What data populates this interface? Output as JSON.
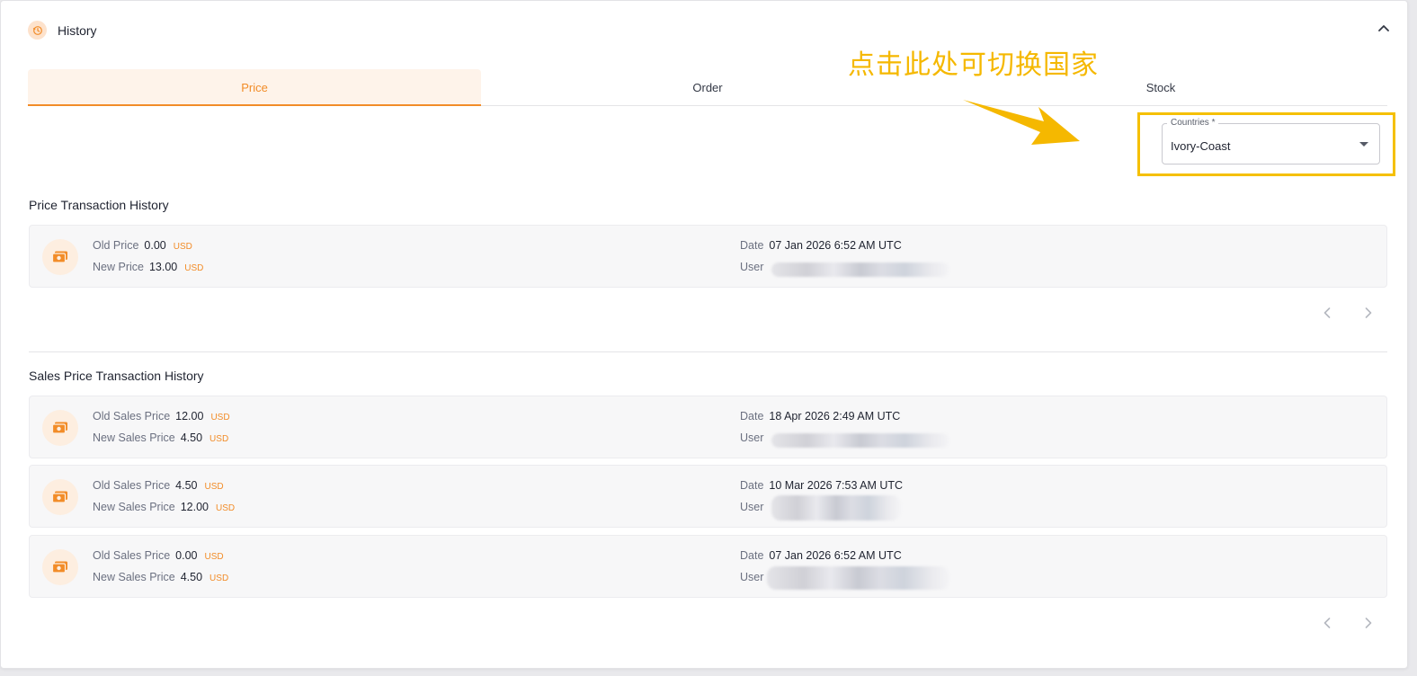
{
  "header": {
    "title": "History"
  },
  "tabs": [
    {
      "label": "Price",
      "active": true
    },
    {
      "label": "Order",
      "active": false
    },
    {
      "label": "Stock",
      "active": false
    }
  ],
  "annotation": {
    "text": "点击此处可切换国家"
  },
  "country_select": {
    "label": "Countries *",
    "value": "Ivory-Coast"
  },
  "price_history": {
    "title": "Price Transaction History",
    "rows": [
      {
        "old_label": "Old Price",
        "old_value": "0.00",
        "old_currency": "USD",
        "new_label": "New Price",
        "new_value": "13.00",
        "new_currency": "USD",
        "date_label": "Date",
        "date": "07 Jan 2026 6:52 AM UTC",
        "user_label": "User"
      }
    ]
  },
  "sales_price_history": {
    "title": "Sales Price Transaction History",
    "rows": [
      {
        "old_label": "Old Sales Price",
        "old_value": "12.00",
        "old_currency": "USD",
        "new_label": "New Sales Price",
        "new_value": "4.50",
        "new_currency": "USD",
        "date_label": "Date",
        "date": "18 Apr 2026 2:49 AM UTC",
        "user_label": "User"
      },
      {
        "old_label": "Old Sales Price",
        "old_value": "4.50",
        "old_currency": "USD",
        "new_label": "New Sales Price",
        "new_value": "12.00",
        "new_currency": "USD",
        "date_label": "Date",
        "date": "10 Mar 2026 7:53 AM UTC",
        "user_label": "User"
      },
      {
        "old_label": "Old Sales Price",
        "old_value": "0.00",
        "old_currency": "USD",
        "new_label": "New Sales Price",
        "new_value": "4.50",
        "new_currency": "USD",
        "date_label": "Date",
        "date": "07 Jan 2026 6:52 AM UTC",
        "user_label": "User"
      }
    ]
  },
  "colors": {
    "accent": "#f28c28",
    "annotation": "#f5b800"
  },
  "icons": {
    "header": "history-icon",
    "row": "money-icon",
    "collapse": "chevron-up-icon",
    "prev": "chevron-left-icon",
    "next": "chevron-right-icon"
  }
}
